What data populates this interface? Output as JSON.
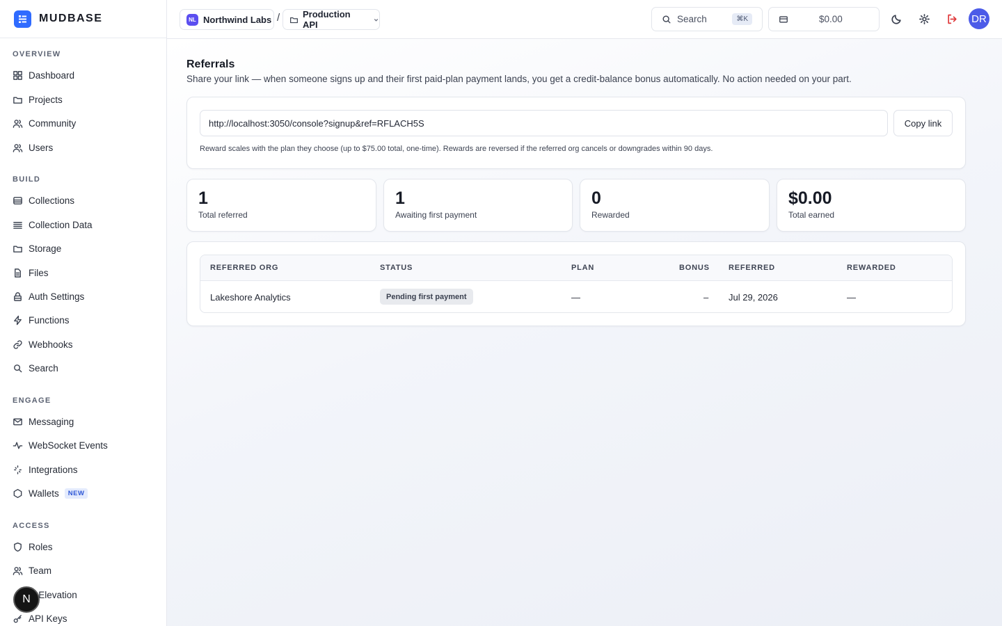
{
  "brand": {
    "name": "MUDBASE",
    "accent": "#2f6bff"
  },
  "sidebar": {
    "sections": [
      {
        "title": "OVERVIEW",
        "items": [
          {
            "label": "Dashboard",
            "icon": "grid-icon"
          },
          {
            "label": "Projects",
            "icon": "folder-icon"
          },
          {
            "label": "Community",
            "icon": "users-icon"
          },
          {
            "label": "Users",
            "icon": "users-icon"
          }
        ]
      },
      {
        "title": "BUILD",
        "items": [
          {
            "label": "Collections",
            "icon": "database-icon"
          },
          {
            "label": "Collection Data",
            "icon": "list-icon"
          },
          {
            "label": "Storage",
            "icon": "folder-icon"
          },
          {
            "label": "Files",
            "icon": "file-icon"
          },
          {
            "label": "Auth Settings",
            "icon": "lock-icon"
          },
          {
            "label": "Functions",
            "icon": "bolt-icon"
          },
          {
            "label": "Webhooks",
            "icon": "link-icon"
          },
          {
            "label": "Search",
            "icon": "search-icon"
          }
        ]
      },
      {
        "title": "ENGAGE",
        "items": [
          {
            "label": "Messaging",
            "icon": "mail-icon"
          },
          {
            "label": "WebSocket Events",
            "icon": "activity-icon"
          },
          {
            "label": "Integrations",
            "icon": "sparkle-icon"
          },
          {
            "label": "Wallets",
            "icon": "hexagon-icon",
            "badge": "NEW"
          }
        ]
      },
      {
        "title": "ACCESS",
        "items": [
          {
            "label": "Roles",
            "icon": "shield-icon"
          },
          {
            "label": "Team",
            "icon": "users-icon"
          },
          {
            "label": "Role Elevation",
            "visible_label": "le Elevation",
            "icon": "arrow-up-icon"
          },
          {
            "label": "API Keys",
            "icon": "key-icon"
          }
        ]
      }
    ],
    "floating_button": "N"
  },
  "topbar": {
    "org": {
      "initials": "NL",
      "name": "Northwind Labs"
    },
    "separator": "/",
    "project": {
      "name": "Production API"
    },
    "search": {
      "placeholder": "Search",
      "shortcut": "⌘K"
    },
    "balance": "$0.00",
    "avatar": "DR"
  },
  "main": {
    "title": "Referrals",
    "subtitle": "Share your link — when someone signs up and their first paid-plan payment lands, you get a credit-balance bonus automatically. No action needed on your part.",
    "link": {
      "value": "http://localhost:3050/console?signup&ref=RFLACH5S",
      "copy_label": "Copy link",
      "note": "Reward scales with the plan they choose (up to $75.00 total, one-time). Rewards are reversed if the referred org cancels or downgrades within 90 days."
    },
    "stats": [
      {
        "value": "1",
        "label": "Total referred"
      },
      {
        "value": "1",
        "label": "Awaiting first payment"
      },
      {
        "value": "0",
        "label": "Rewarded"
      },
      {
        "value": "$0.00",
        "label": "Total earned"
      }
    ],
    "table": {
      "columns": [
        "REFERRED ORG",
        "STATUS",
        "PLAN",
        "BONUS",
        "REFERRED",
        "REWARDED"
      ],
      "rows": [
        {
          "org": "Lakeshore Analytics",
          "status": "Pending first payment",
          "plan": "—",
          "bonus": "–",
          "referred": "Jul 29, 2026",
          "rewarded": "—"
        }
      ]
    }
  }
}
